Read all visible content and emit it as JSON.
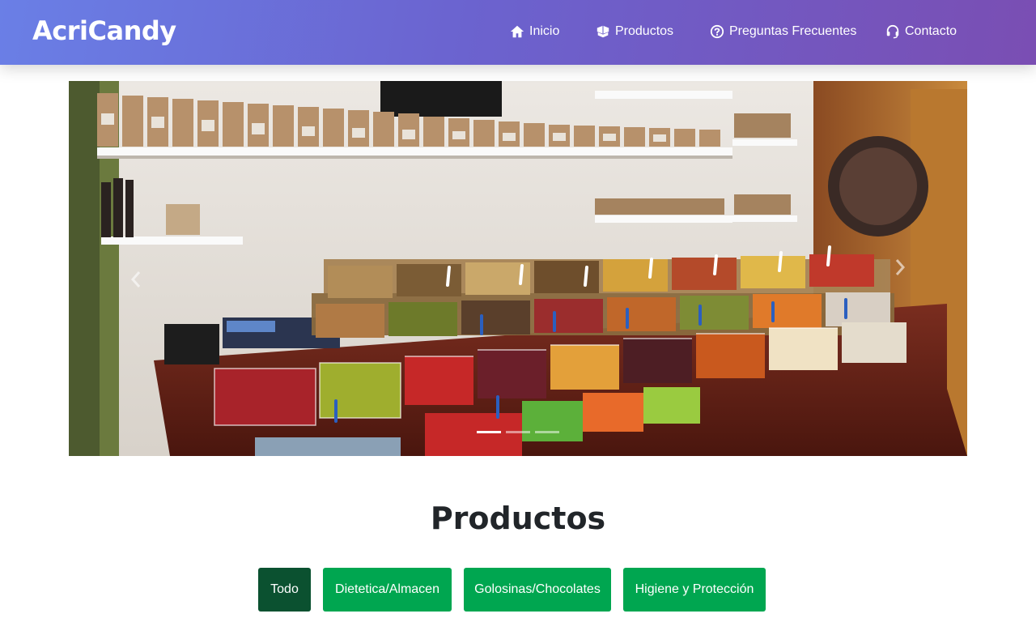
{
  "brand": {
    "name": "AcriCandy"
  },
  "nav": {
    "items": [
      {
        "label": "Inicio",
        "icon": "home-icon"
      },
      {
        "label": "Productos",
        "icon": "boxes-icon"
      },
      {
        "label": "Preguntas Frecuentes",
        "icon": "question-circle-icon"
      },
      {
        "label": "Contacto",
        "icon": "headset-icon"
      }
    ]
  },
  "carousel": {
    "slide_count": 3,
    "active_slide": 1,
    "image_subject": "bulk candy and dried fruit store counter with acrylic bins",
    "prev_icon": "chevron-left-icon",
    "next_icon": "chevron-right-icon"
  },
  "products": {
    "title": "Productos",
    "filters": [
      {
        "label": "Todo",
        "active": true
      },
      {
        "label": "Dietetica/Almacen",
        "active": false
      },
      {
        "label": "Golosinas/Chocolates",
        "active": false
      },
      {
        "label": "Higiene y Protección",
        "active": false
      }
    ]
  },
  "colors": {
    "nav_gradient_start": "#6a7fe6",
    "nav_gradient_end": "#7a4eb3",
    "filter_green": "#00a650",
    "filter_active": "#0b5130"
  }
}
